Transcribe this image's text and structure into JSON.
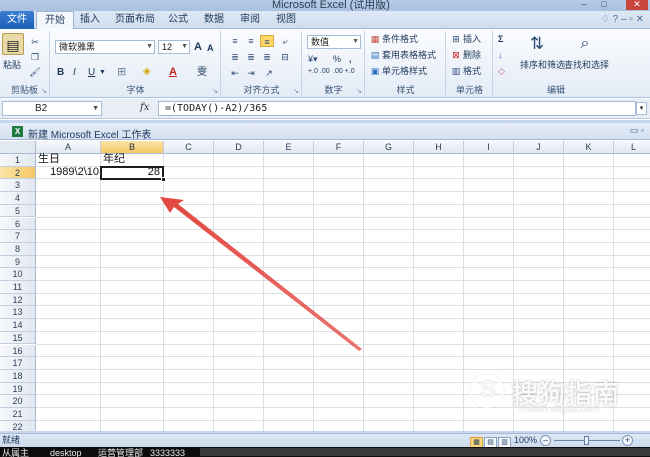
{
  "window": {
    "title": "Microsoft Excel (试用版)",
    "minimize": "–",
    "maximize": "□",
    "close": "✕"
  },
  "ribbon_tabs": [
    "文件",
    "开始",
    "插入",
    "页面布局",
    "公式",
    "数据",
    "审阅",
    "视图"
  ],
  "ribbon_right_icons": "♢ ? – ▫ ✕",
  "clipboard": {
    "paste": "粘贴",
    "label": "剪贴板"
  },
  "font": {
    "name": "微软雅黑",
    "size": "12",
    "grow": "A",
    "shrink": "A",
    "bold": "B",
    "italic": "I",
    "underline": "U",
    "font_color": "A",
    "phonetic": "雯",
    "label": "字体"
  },
  "alignment": {
    "label": "对齐方式"
  },
  "number": {
    "format": "数值",
    "percent": "%",
    "comma": ",",
    "inc_decimal": "+.0 .00",
    "dec_decimal": ".00 +.0",
    "label": "数字"
  },
  "styles": {
    "conditional": "条件格式",
    "table": "套用表格格式",
    "cell": "单元格样式",
    "label": "样式"
  },
  "cells_group": {
    "insert": "插入",
    "delete": "删除",
    "format": "格式",
    "label": "单元格"
  },
  "editing": {
    "sum": "Σ",
    "fill": "↓",
    "clear": "◇",
    "sort": "排序和筛选",
    "find": "查找和选择",
    "label": "编辑"
  },
  "formula_bar": {
    "name_box": "B2",
    "fx": "fx",
    "formula": "=(TODAY()-A2)/365",
    "expand": "▾"
  },
  "workbook": {
    "title": "新建 Microsoft Excel 工作表",
    "controls": "▭ ▫"
  },
  "grid": {
    "columns": [
      "A",
      "B",
      "C",
      "D",
      "E",
      "F",
      "G",
      "H",
      "I",
      "J",
      "K",
      "L"
    ],
    "rows": [
      "1",
      "2",
      "3",
      "4",
      "5",
      "6",
      "7",
      "8",
      "9",
      "10",
      "11",
      "12",
      "13",
      "14",
      "15",
      "16",
      "17",
      "18",
      "19",
      "20",
      "21",
      "22"
    ],
    "cells": {
      "A1": "生日",
      "B1": "年纪",
      "A2": "1989\\2\\10",
      "B2": "28"
    },
    "selected_col": "B",
    "selected_row": "2"
  },
  "status_bar": {
    "ready": "就绪",
    "zoom": "100%",
    "zoom_minus": "–",
    "zoom_plus": "+"
  },
  "watermark": {
    "text": "搜狗指南",
    "sub": "zhinan.sogou.com"
  },
  "taskbar": {
    "item1": "从属主",
    "item2": "desktop",
    "item3": "运营管理部",
    "item4": "3333333"
  },
  "colors": {
    "accent": "#1c5fb7",
    "selection_header": "#f5c865",
    "arrow": "#e2473f"
  }
}
